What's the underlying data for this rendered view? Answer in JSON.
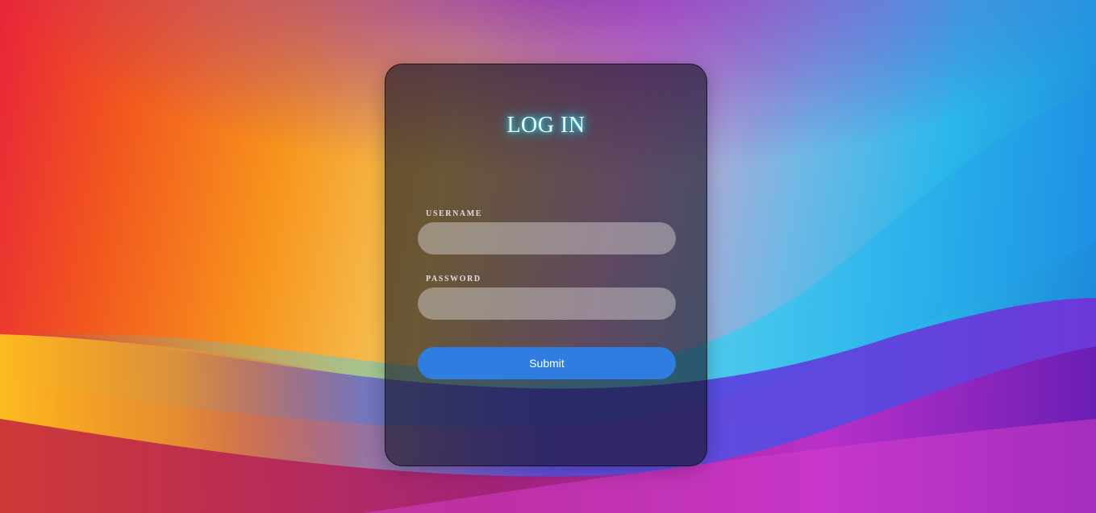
{
  "login": {
    "title": "LOG IN",
    "username_label": "USERNAME",
    "username_value": "",
    "password_label": "PASSWORD",
    "password_value": "",
    "submit_label": "Submit"
  },
  "colors": {
    "submit_button": "#2f7de0",
    "title_glow": "#37e5f5"
  }
}
